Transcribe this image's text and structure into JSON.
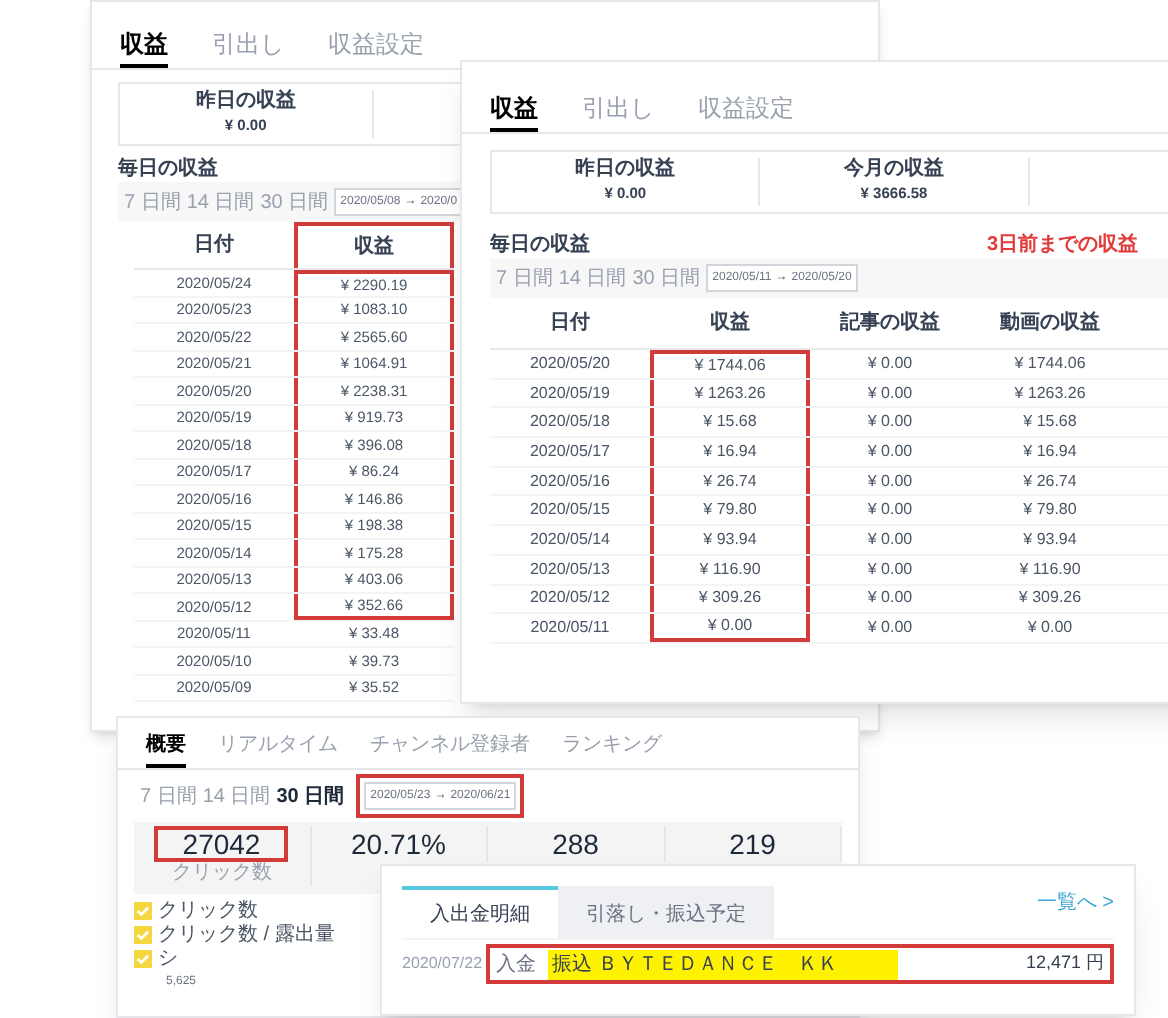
{
  "earnings_back": {
    "tabs": [
      {
        "label": "収益",
        "selected": true
      },
      {
        "label": "引出し",
        "selected": false
      },
      {
        "label": "収益設定",
        "selected": false
      }
    ],
    "summary": [
      {
        "label": "昨日の収益",
        "value": "¥ 0.00"
      }
    ],
    "section_title": "毎日の収益",
    "periods": [
      {
        "label": "7 日間",
        "selected": false
      },
      {
        "label": "14 日間",
        "selected": false
      },
      {
        "label": "30 日間",
        "selected": false
      }
    ],
    "date_range": {
      "start": "2020/05/08",
      "arrow": "→",
      "end": "2020/0"
    },
    "columns": [
      {
        "label": "日付",
        "framed": false
      },
      {
        "label": "収益",
        "framed": true
      }
    ],
    "rows": [
      {
        "date": "2020/05/24",
        "earnings": "¥ 2290.19",
        "framed": true
      },
      {
        "date": "2020/05/23",
        "earnings": "¥ 1083.10",
        "framed": true
      },
      {
        "date": "2020/05/22",
        "earnings": "¥ 2565.60",
        "framed": true
      },
      {
        "date": "2020/05/21",
        "earnings": "¥ 1064.91",
        "framed": true
      },
      {
        "date": "2020/05/20",
        "earnings": "¥ 2238.31",
        "framed": true
      },
      {
        "date": "2020/05/19",
        "earnings": "¥ 919.73",
        "framed": true
      },
      {
        "date": "2020/05/18",
        "earnings": "¥ 396.08",
        "framed": true
      },
      {
        "date": "2020/05/17",
        "earnings": "¥ 86.24",
        "framed": true
      },
      {
        "date": "2020/05/16",
        "earnings": "¥ 146.86",
        "framed": true
      },
      {
        "date": "2020/05/15",
        "earnings": "¥ 198.38",
        "framed": true
      },
      {
        "date": "2020/05/14",
        "earnings": "¥ 175.28",
        "framed": true
      },
      {
        "date": "2020/05/13",
        "earnings": "¥ 403.06",
        "framed": true
      },
      {
        "date": "2020/05/12",
        "earnings": "¥ 352.66",
        "framed": true
      },
      {
        "date": "2020/05/11",
        "earnings": "¥ 33.48",
        "framed": false
      },
      {
        "date": "2020/05/10",
        "earnings": "¥ 39.73",
        "framed": false
      },
      {
        "date": "2020/05/09",
        "earnings": "¥ 35.52",
        "framed": false
      }
    ]
  },
  "earnings_front": {
    "tabs": [
      {
        "label": "収益",
        "selected": true
      },
      {
        "label": "引出し",
        "selected": false
      },
      {
        "label": "収益設定",
        "selected": false
      }
    ],
    "summary": [
      {
        "label": "昨日の収益",
        "value": "¥ 0.00"
      },
      {
        "label": "今月の収益",
        "value": "¥ 3666.58"
      }
    ],
    "section_title": "毎日の収益",
    "notice": "3日前までの収益",
    "periods": [
      {
        "label": "7 日間",
        "selected": false
      },
      {
        "label": "14 日間",
        "selected": false
      },
      {
        "label": "30 日間",
        "selected": false
      }
    ],
    "date_range": {
      "start": "2020/05/11",
      "arrow": "→",
      "end": "2020/05/20"
    },
    "columns": [
      {
        "label": "日付",
        "framed": false
      },
      {
        "label": "収益",
        "framed": false
      },
      {
        "label": "記事の収益",
        "framed": false
      },
      {
        "label": "動画の収益",
        "framed": false
      }
    ],
    "rows": [
      {
        "date": "2020/05/20",
        "earnings": "¥ 1744.06",
        "articles": "¥ 0.00",
        "videos": "¥ 1744.06",
        "framed": true
      },
      {
        "date": "2020/05/19",
        "earnings": "¥ 1263.26",
        "articles": "¥ 0.00",
        "videos": "¥ 1263.26",
        "framed": true
      },
      {
        "date": "2020/05/18",
        "earnings": "¥ 15.68",
        "articles": "¥ 0.00",
        "videos": "¥ 15.68",
        "framed": true
      },
      {
        "date": "2020/05/17",
        "earnings": "¥ 16.94",
        "articles": "¥ 0.00",
        "videos": "¥ 16.94",
        "framed": true
      },
      {
        "date": "2020/05/16",
        "earnings": "¥ 26.74",
        "articles": "¥ 0.00",
        "videos": "¥ 26.74",
        "framed": true
      },
      {
        "date": "2020/05/15",
        "earnings": "¥ 79.80",
        "articles": "¥ 0.00",
        "videos": "¥ 79.80",
        "framed": true
      },
      {
        "date": "2020/05/14",
        "earnings": "¥ 93.94",
        "articles": "¥ 0.00",
        "videos": "¥ 93.94",
        "framed": true
      },
      {
        "date": "2020/05/13",
        "earnings": "¥ 116.90",
        "articles": "¥ 0.00",
        "videos": "¥ 116.90",
        "framed": true
      },
      {
        "date": "2020/05/12",
        "earnings": "¥ 309.26",
        "articles": "¥ 0.00",
        "videos": "¥ 309.26",
        "framed": true
      },
      {
        "date": "2020/05/11",
        "earnings": "¥ 0.00",
        "articles": "¥ 0.00",
        "videos": "¥ 0.00",
        "framed": true
      }
    ]
  },
  "analytics": {
    "tabs": [
      {
        "label": "概要",
        "selected": true
      },
      {
        "label": "リアルタイム",
        "selected": false
      },
      {
        "label": "チャンネル登録者",
        "selected": false
      },
      {
        "label": "ランキング",
        "selected": false
      }
    ],
    "periods": [
      {
        "label": "7 日間",
        "selected": false
      },
      {
        "label": "14 日間",
        "selected": false
      },
      {
        "label": "30 日間",
        "selected": true
      }
    ],
    "date_range": {
      "start": "2020/05/23",
      "arrow": "→",
      "end": "2020/06/21",
      "framed": true
    },
    "stats": [
      {
        "value": "27042",
        "label": "クリック数",
        "framed": true
      },
      {
        "value": "20.71%",
        "framed": false
      },
      {
        "value": "288",
        "framed": false
      },
      {
        "value": "219",
        "framed": false
      }
    ],
    "legend": [
      {
        "label": "クリック数",
        "checked": true
      },
      {
        "label": "クリック数 / 露出量",
        "checked": true
      },
      {
        "label": "シ",
        "checked": true
      }
    ],
    "chart": {
      "axis_label": "5,625"
    }
  },
  "bank": {
    "tabs": [
      {
        "label": "入出金明細",
        "selected": true
      },
      {
        "label": "引落し・振込予定",
        "selected": false
      }
    ],
    "link": "一覧へ >",
    "transactions": [
      {
        "date": "2020/07/22",
        "type": "入金",
        "description": "振込 ＢＹＴＥＤＡＮＣＥ　ＫＫ",
        "amount": "12,471 円",
        "marked": true,
        "framed": true
      }
    ]
  }
}
